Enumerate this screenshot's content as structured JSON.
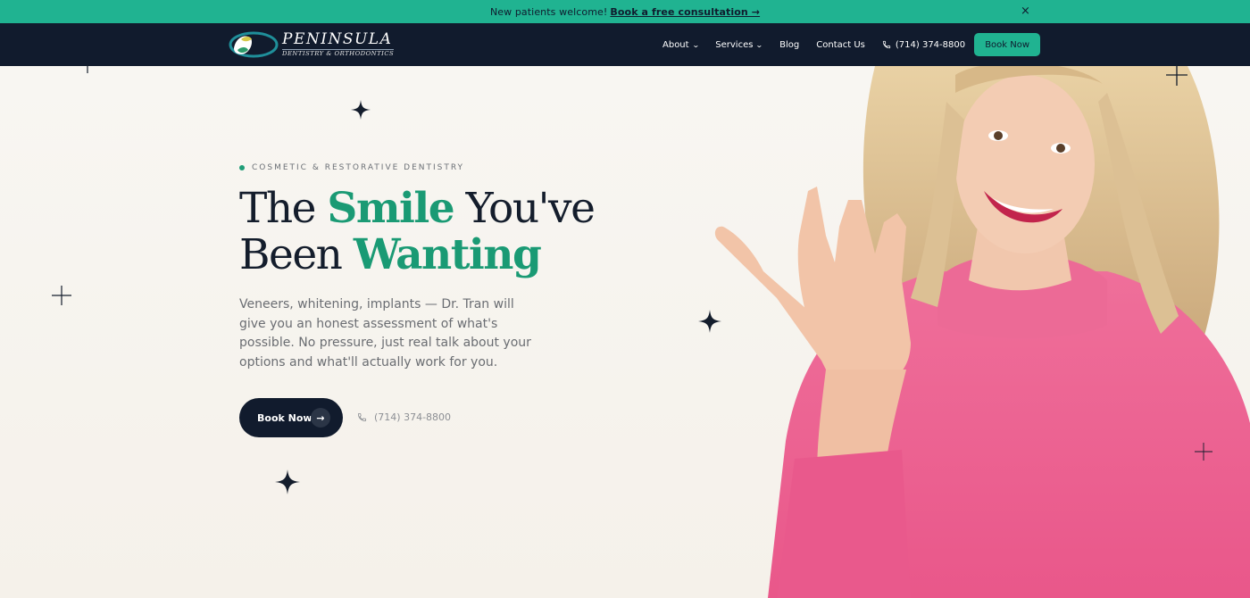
{
  "announcement": {
    "text": "New patients welcome!",
    "link_label": "Book a free consultation →",
    "close_glyph": "×"
  },
  "brand": {
    "name": "PENINSULA",
    "tagline": "DENTISTRY & ORTHODONTICS",
    "accent_color": "#20b391",
    "navy": "#111b2d",
    "green_text": "#1a9a74"
  },
  "nav": {
    "items": [
      {
        "label": "About",
        "has_dropdown": true
      },
      {
        "label": "Services",
        "has_dropdown": true
      },
      {
        "label": "Blog",
        "has_dropdown": false
      },
      {
        "label": "Contact Us",
        "has_dropdown": false
      }
    ],
    "phone": "(714) 374-8800",
    "book_label": "Book Now",
    "chevron": "⌄"
  },
  "hero": {
    "eyebrow": "COSMETIC & RESTORATIVE DENTISTRY",
    "headline": {
      "line1_a": "The ",
      "line1_accent": "Smile",
      "line1_b": " You've",
      "line2_a": "Been ",
      "line2_accent": "Wanting"
    },
    "body": "Veneers, whitening, implants — Dr. Tran will give you an honest assessment of what's possible. No pressure, just real talk about your options and what'll actually work for you.",
    "cta_label": "Book Now",
    "cta_arrow": "→",
    "phone": "(714) 374-8800"
  },
  "icons": {
    "close": "close-icon",
    "phone": "phone-icon",
    "arrow": "arrow-right-icon",
    "sparkle": "sparkle-icon",
    "plus": "plus-icon"
  }
}
